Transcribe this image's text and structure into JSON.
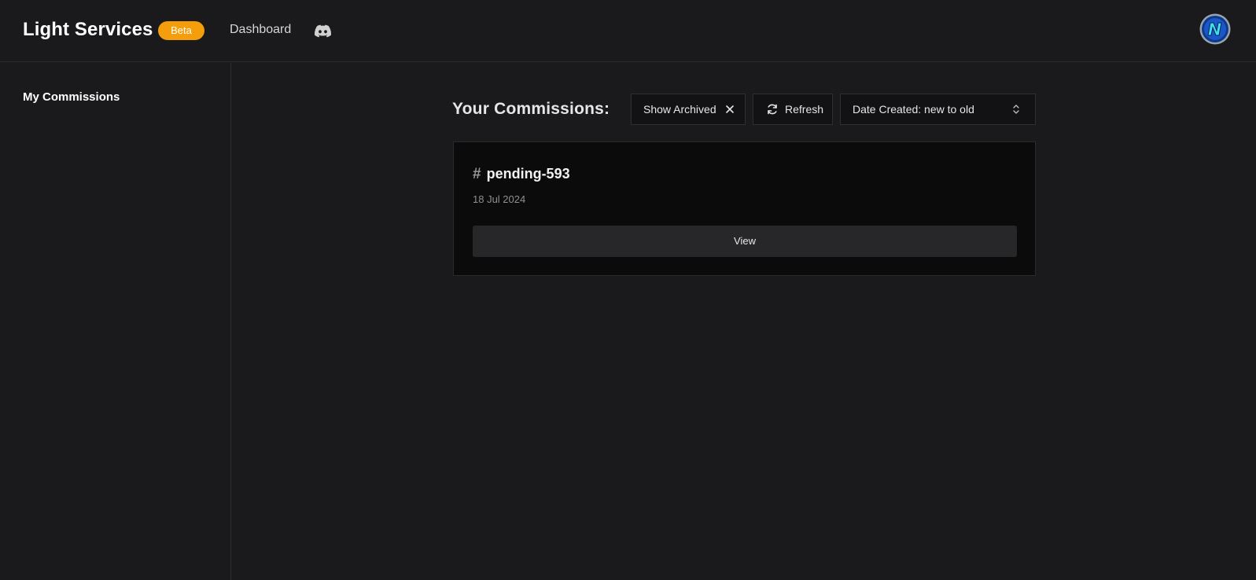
{
  "header": {
    "brand": "Light Services",
    "badge": "Beta",
    "nav_dashboard": "Dashboard",
    "discord_icon": "discord-icon",
    "avatar_icon": "avatar"
  },
  "sidebar": {
    "items": [
      {
        "label": "My Commissions"
      }
    ]
  },
  "main": {
    "heading": "Your Commissions:",
    "show_archived_label": "Show Archived",
    "refresh_label": "Refresh",
    "sort_selected": "Date Created: new to old",
    "commissions": [
      {
        "hash": "#",
        "name": "pending-593",
        "date": "18 Jul 2024",
        "action": "View"
      }
    ]
  },
  "colors": {
    "background": "#1a1a1d",
    "badge": "#f59e0b",
    "card": "#0b0b0c",
    "button": "#272729"
  }
}
